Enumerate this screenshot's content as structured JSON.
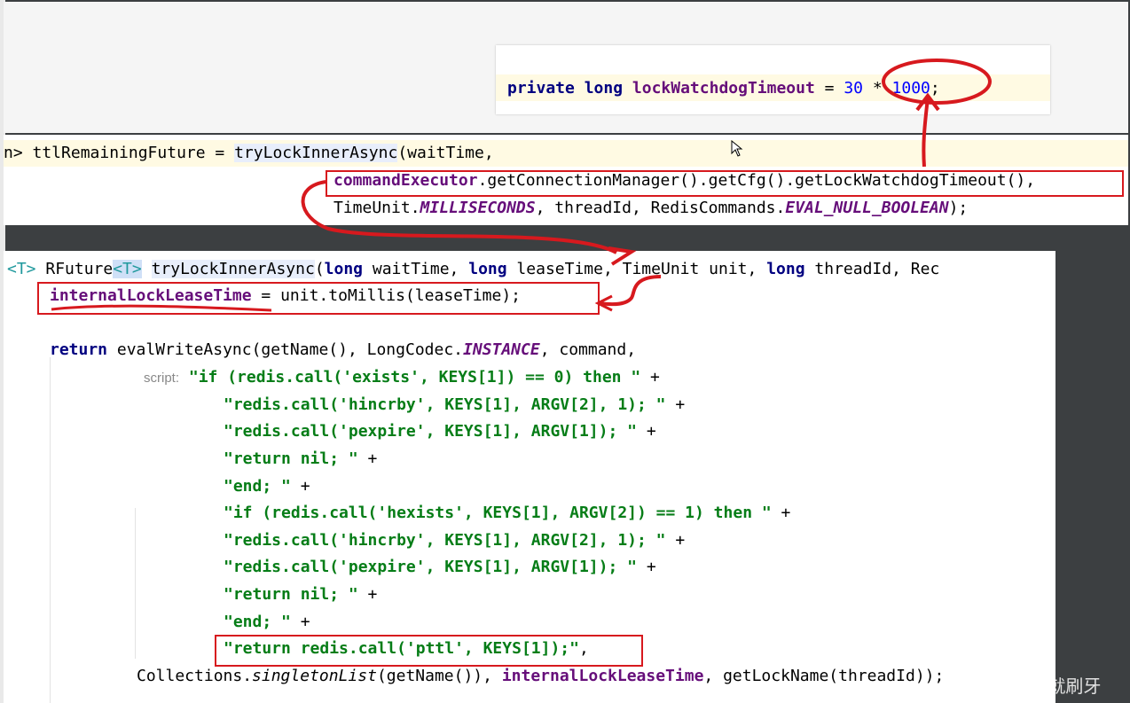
{
  "snippet_top": {
    "kw_private": "private",
    "kw_long": "long",
    "field": "lockWatchdogTimeout",
    "eq": " = ",
    "num1": "30",
    "op": " * ",
    "num2": "1000",
    "semi": ";"
  },
  "snippet_mid": {
    "line1_prefix": "n> ttlRemainingFuture = ",
    "line1_method": "tryLockInnerAsync",
    "line1_suffix": "(waitTime,",
    "line2_field": "commandExecutor",
    "line2_rest": ".getConnectionManager().getCfg().getLockWatchdogTimeout(),",
    "line3_a": "TimeUnit.",
    "line3_const1": "MILLISECONDS",
    "line3_b": ", threadId, RedisCommands.",
    "line3_const2": "EVAL_NULL_BOOLEAN",
    "line3_c": ");"
  },
  "snippet_main": {
    "sig_gen1": "<T>",
    "sig_type": " RFuture",
    "sig_gen2": "<T>",
    "sig_method": "tryLockInnerAsync",
    "sig_p1": "(",
    "sig_long": "long",
    "sig_p2": " waitTime, ",
    "sig_p3": " leaseTime, TimeUnit unit, ",
    "sig_p4": " threadId, Rec",
    "assign_field": "internalLockLeaseTime",
    "assign_rest": " = unit.toMillis(leaseTime);",
    "ret_kw": "return",
    "ret_a": " evalWriteAsync(getName(), LongCodec.",
    "ret_const": "INSTANCE",
    "ret_b": ", command,",
    "script_hint": "script:",
    "plus": " +",
    "script_lines": [
      "\"if (redis.call('exists', KEYS[1]) == 0) then \"",
      "\"redis.call('hincrby', KEYS[1], ARGV[2], 1); \"",
      "\"redis.call('pexpire', KEYS[1], ARGV[1]); \"",
      "\"return nil; \"",
      "\"end; \"",
      "\"if (redis.call('hexists', KEYS[1], ARGV[2]) == 1) then \"",
      "\"redis.call('hincrby', KEYS[1], ARGV[2], 1); \"",
      "\"redis.call('pexpire', KEYS[1], ARGV[1]); \"",
      "\"return nil; \"",
      "\"end; \"",
      "\"return redis.call('pttl', KEYS[1]);\""
    ],
    "last_comma": ",",
    "coll_a": "Collections.",
    "coll_method": "singletonList",
    "coll_b": "(getName()), ",
    "coll_field": "internalLockLeaseTime",
    "coll_c": ", getLockName(threadId));"
  },
  "watermark": "CSDN @醒了就刷牙",
  "colors": {
    "annotation": "#d7191e",
    "keyword": "#000080",
    "field": "#660e7a",
    "string": "#067d17"
  }
}
